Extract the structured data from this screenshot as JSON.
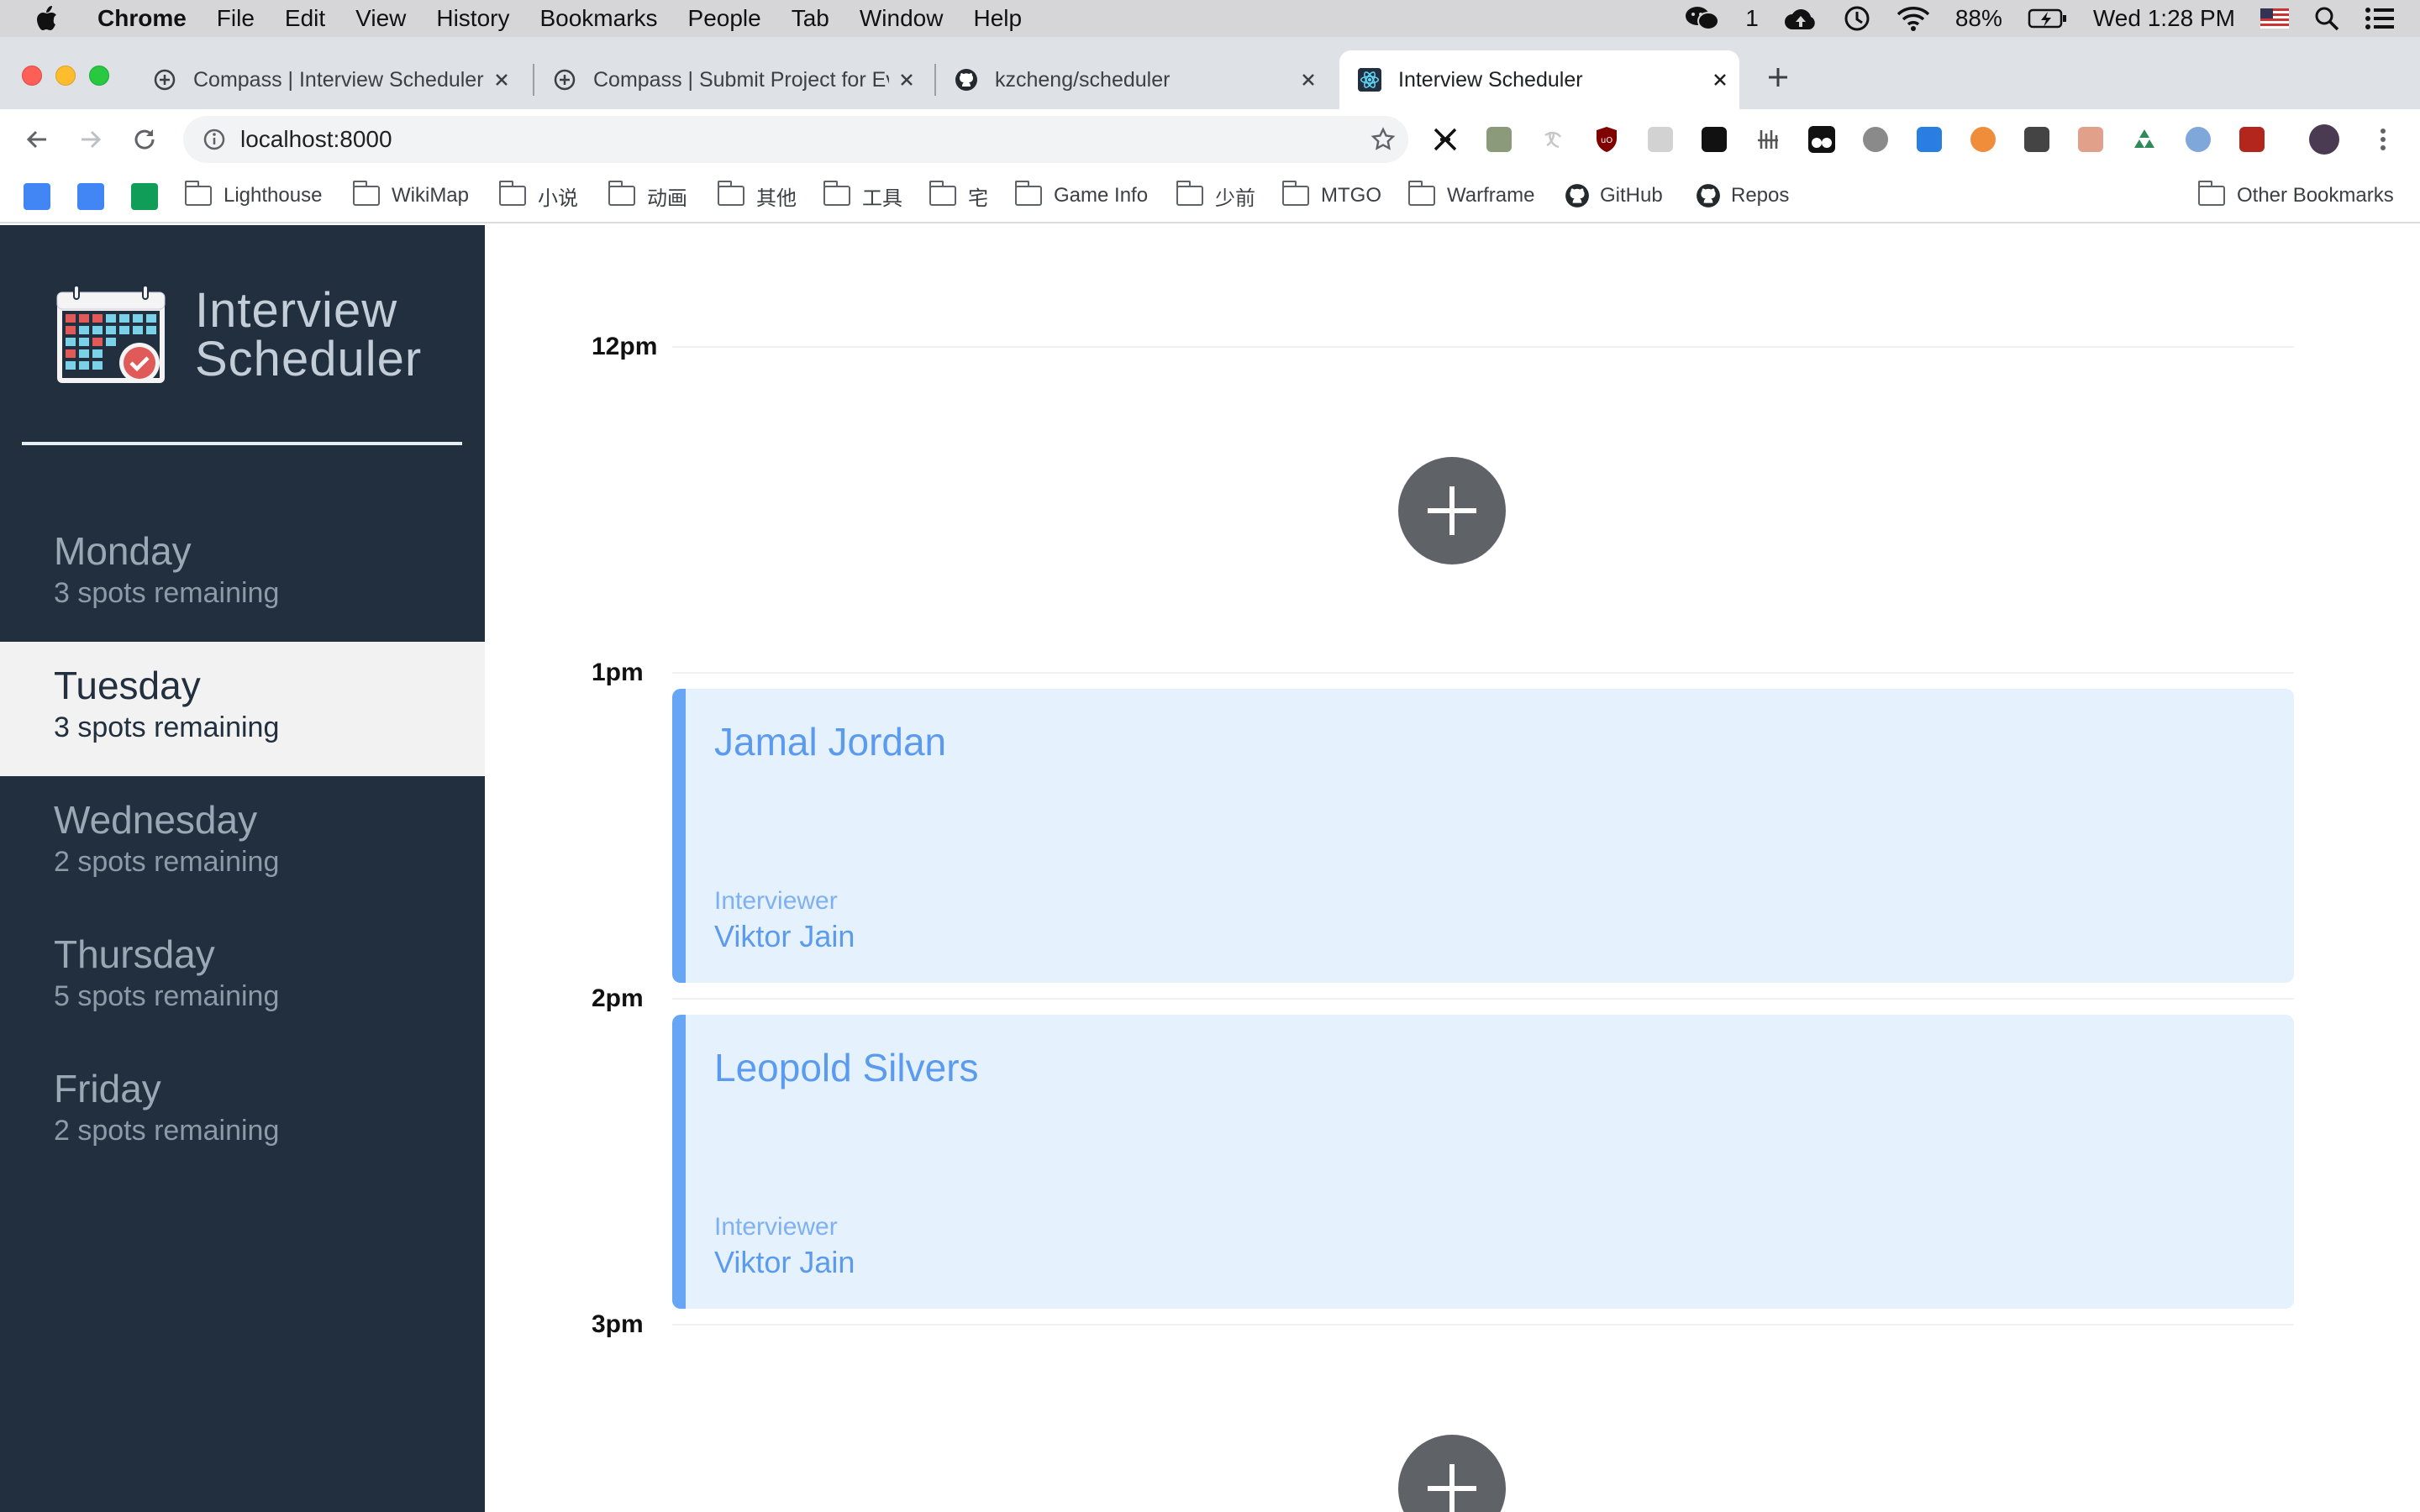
{
  "menubar": {
    "app_name": "Chrome",
    "items": [
      "File",
      "Edit",
      "View",
      "History",
      "Bookmarks",
      "People",
      "Tab",
      "Window",
      "Help"
    ],
    "wechat_count": "1",
    "battery": "88%",
    "clock": "Wed 1:28 PM"
  },
  "tabs": [
    {
      "title": "Compass | Interview Scheduler",
      "icon": "compass-icon"
    },
    {
      "title": "Compass | Submit Project for Ev",
      "icon": "compass-icon"
    },
    {
      "title": "kzcheng/scheduler",
      "icon": "github-icon"
    },
    {
      "title": "Interview Scheduler",
      "icon": "react-icon",
      "active": true
    }
  ],
  "toolbar": {
    "url": "localhost:8000"
  },
  "bookmarks": {
    "items": [
      "Lighthouse",
      "WikiMap",
      "小说",
      "动画",
      "其他",
      "工具",
      "宅",
      "Game Info",
      "少前",
      "MTGO",
      "Warframe",
      "GitHub",
      "Repos"
    ],
    "other": "Other Bookmarks"
  },
  "app": {
    "brand": {
      "line1": "Interview",
      "line2": "Scheduler"
    },
    "days": [
      {
        "name": "Monday",
        "spots": "3 spots remaining"
      },
      {
        "name": "Tuesday",
        "spots": "3 spots remaining",
        "selected": true
      },
      {
        "name": "Wednesday",
        "spots": "2 spots remaining"
      },
      {
        "name": "Thursday",
        "spots": "5 spots remaining"
      },
      {
        "name": "Friday",
        "spots": "2 spots remaining"
      }
    ],
    "times": [
      "12pm",
      "1pm",
      "2pm",
      "3pm"
    ],
    "appointments": [
      {
        "student": "Jamal Jordan",
        "interviewer_label": "Interviewer",
        "interviewer": "Viktor Jain"
      },
      {
        "student": "Leopold Silvers",
        "interviewer_label": "Interviewer",
        "interviewer": "Viktor Jain"
      }
    ],
    "colors": {
      "sidebar": "#222f3e",
      "selected_day": "#f2f2f2",
      "appointment_bg": "#e5f1fd",
      "appointment_accent": "#66a6f4",
      "add_button": "#5f6367"
    }
  }
}
